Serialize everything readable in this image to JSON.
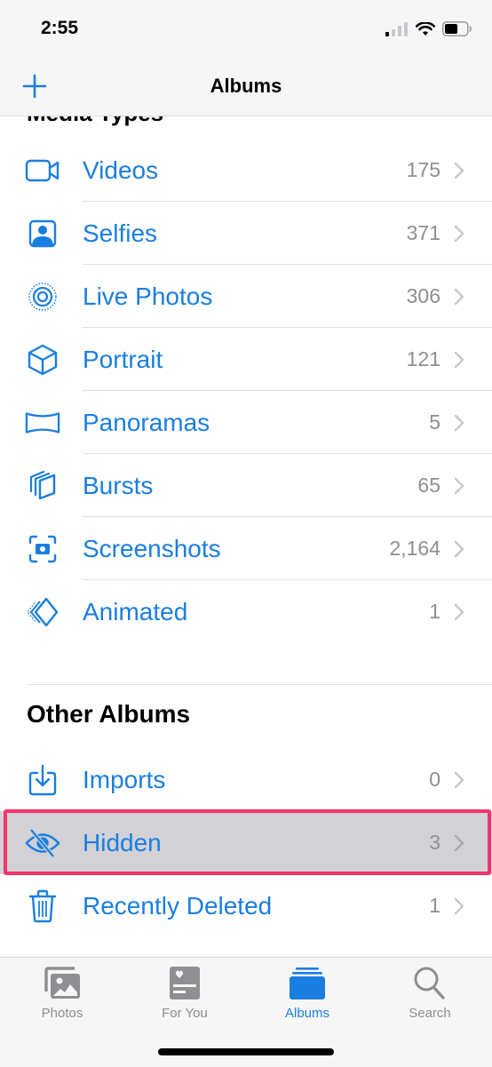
{
  "status_bar": {
    "time": "2:55"
  },
  "nav": {
    "title": "Albums",
    "add_label": "+"
  },
  "media_types": {
    "section_title": "Media Types",
    "items": [
      {
        "label": "Videos",
        "count": "175",
        "icon": "video-icon"
      },
      {
        "label": "Selfies",
        "count": "371",
        "icon": "selfie-icon"
      },
      {
        "label": "Live Photos",
        "count": "306",
        "icon": "live-photo-icon"
      },
      {
        "label": "Portrait",
        "count": "121",
        "icon": "cube-icon"
      },
      {
        "label": "Panoramas",
        "count": "5",
        "icon": "panorama-icon"
      },
      {
        "label": "Bursts",
        "count": "65",
        "icon": "bursts-icon"
      },
      {
        "label": "Screenshots",
        "count": "2,164",
        "icon": "screenshot-icon"
      },
      {
        "label": "Animated",
        "count": "1",
        "icon": "animated-icon"
      }
    ]
  },
  "other_albums": {
    "section_title": "Other Albums",
    "items": [
      {
        "label": "Imports",
        "count": "0",
        "icon": "import-icon"
      },
      {
        "label": "Hidden",
        "count": "3",
        "icon": "hidden-eye-icon",
        "highlighted": true
      },
      {
        "label": "Recently Deleted",
        "count": "1",
        "icon": "trash-icon"
      }
    ]
  },
  "tab_bar": {
    "tabs": [
      {
        "label": "Photos",
        "icon": "photos-icon",
        "active": false
      },
      {
        "label": "For You",
        "icon": "for-you-icon",
        "active": false
      },
      {
        "label": "Albums",
        "icon": "albums-icon",
        "active": true
      },
      {
        "label": "Search",
        "icon": "search-icon",
        "active": false
      }
    ]
  },
  "colors": {
    "accent": "#1a7ee0",
    "highlight_border": "#f5336b",
    "highlight_fill": "#d1d1d6",
    "count_gray": "#8e8e93"
  }
}
